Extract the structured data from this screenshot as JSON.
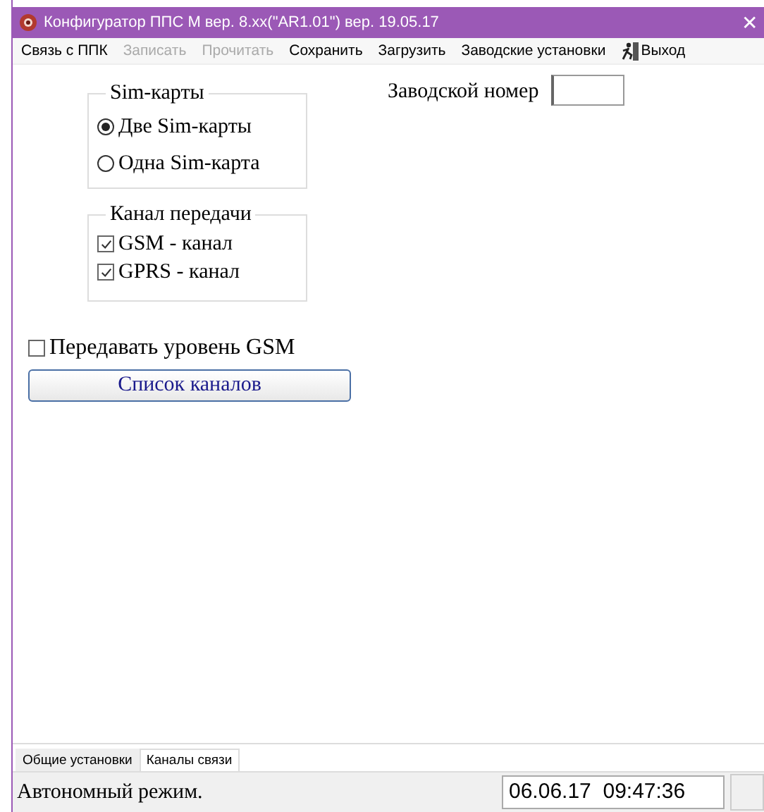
{
  "window": {
    "title": "Конфигуратор ППС М вер. 8.xx(\"AR1.01\") вер. 19.05.17",
    "close": "✕"
  },
  "menu": [
    {
      "label": "Связь с ППК",
      "disabled": false
    },
    {
      "label": "Записать",
      "disabled": true
    },
    {
      "label": "Прочитать",
      "disabled": true
    },
    {
      "label": "Сохранить",
      "disabled": false
    },
    {
      "label": "Загрузить",
      "disabled": false
    },
    {
      "label": "Заводские установки",
      "disabled": false
    },
    {
      "label": "Выход",
      "disabled": false,
      "kind": "exit"
    }
  ],
  "sim_group": {
    "title": "Sim-карты",
    "options": [
      {
        "label": "Две Sim-карты",
        "selected": true
      },
      {
        "label": "Одна Sim-карта",
        "selected": false
      }
    ]
  },
  "channel_group": {
    "title": "Канал передачи",
    "options": [
      {
        "label": "GSM - канал",
        "checked": true
      },
      {
        "label": "GPRS - канал",
        "checked": true
      }
    ]
  },
  "send_gsm_level": {
    "label": "Передавать уровень GSM",
    "checked": false
  },
  "channels_button": "Список каналов",
  "serial": {
    "label": "Заводской номер"
  },
  "tabs": [
    {
      "label": "Общие установки",
      "selected": false
    },
    {
      "label": "Каналы связи",
      "selected": true
    }
  ],
  "status_bar": {
    "mode": "Автономный режим.",
    "datetime": "06.06.17  09:47:36"
  }
}
